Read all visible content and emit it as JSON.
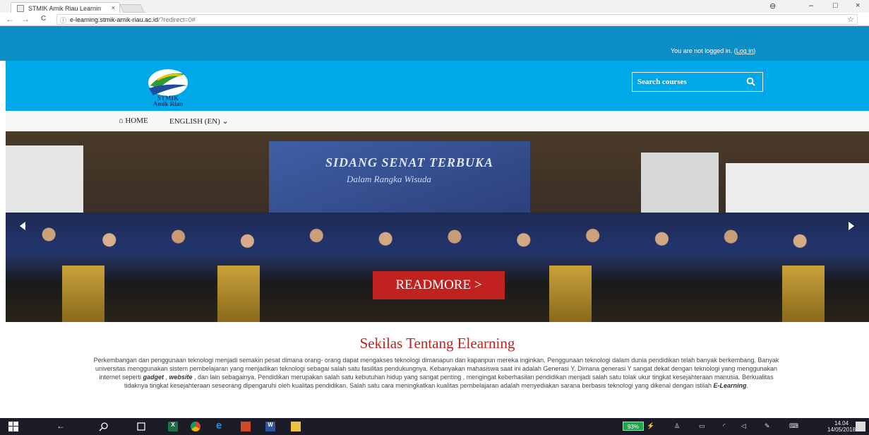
{
  "browser": {
    "tab_title": "STMIK Amik Riau Learnin",
    "tab_close": "×",
    "url_host": "e-learning.stmik-amik-riau.ac.id",
    "url_path": "/?redirect=0#",
    "back": "←",
    "forward": "→",
    "reload": "C",
    "info": "ⓘ",
    "star": "☆",
    "account": "⊖",
    "minimize": "–",
    "maximize": "□",
    "close": "×"
  },
  "login": {
    "prefix": "You are not logged in. (",
    "link": "Log in",
    "suffix": ")"
  },
  "header": {
    "logo_text_1": "STMIK",
    "logo_text_2": "Amik Riau",
    "search_placeholder": "Search courses"
  },
  "nav": {
    "home": "HOME",
    "language": "ENGLISH (EN)"
  },
  "hero": {
    "banner_title": "SIDANG SENAT TERBUKA",
    "banner_subtitle": "Dalam Rangka Wisuda",
    "readmore": "READMORE >"
  },
  "content": {
    "title": "Sekilas Tentang Elearning",
    "p1": "Perkembangan dan penggunaan teknologi menjadi semakin pesat dimana orang- orang dapat mengakses teknologi dimanapun dan kapanpun mereka inginkan. Penggunaan teknologi dalam dunia pendidikan telah banyak berkembang. Banyak universitas menggunakan sistem pembelajaran yang menjadikan teknologi sebagai salah satu fasilitas pendukungnya. Kebanyakan mahasiswa saat ini adalah Generasi Y. Dimana generasi Y sangat dekat dengan teknologi yang menggunakan internet seperti ",
    "em1": "gadget",
    "sep1": " , ",
    "em2": "website",
    "p2": " , dan lain sebagainya. Pendidikan merupakan salah satu kebutuhan hidup yang sangat penting , mengingat keberhasilan pendidikan menjadi salah satu tolak ukur tingkat kesejahteraan manusia. Berkualitas tidaknya tingkat kesejahteraan seseorang dipengaruhi oleh kualitas pendidikan. Salah satu cara meningkatkan kualitas pembelajaran adalah menyediakan sarana berbasis teknologi yang dikenal dengan istilah ",
    "em3": "E-Learning",
    "p3": "."
  },
  "taskbar": {
    "battery": "93%",
    "time": "14.04",
    "date": "14/05/2018"
  },
  "colors": {
    "topbar": "#0e8ec6",
    "header": "#00a8e8",
    "accent_red": "#c0231f"
  }
}
